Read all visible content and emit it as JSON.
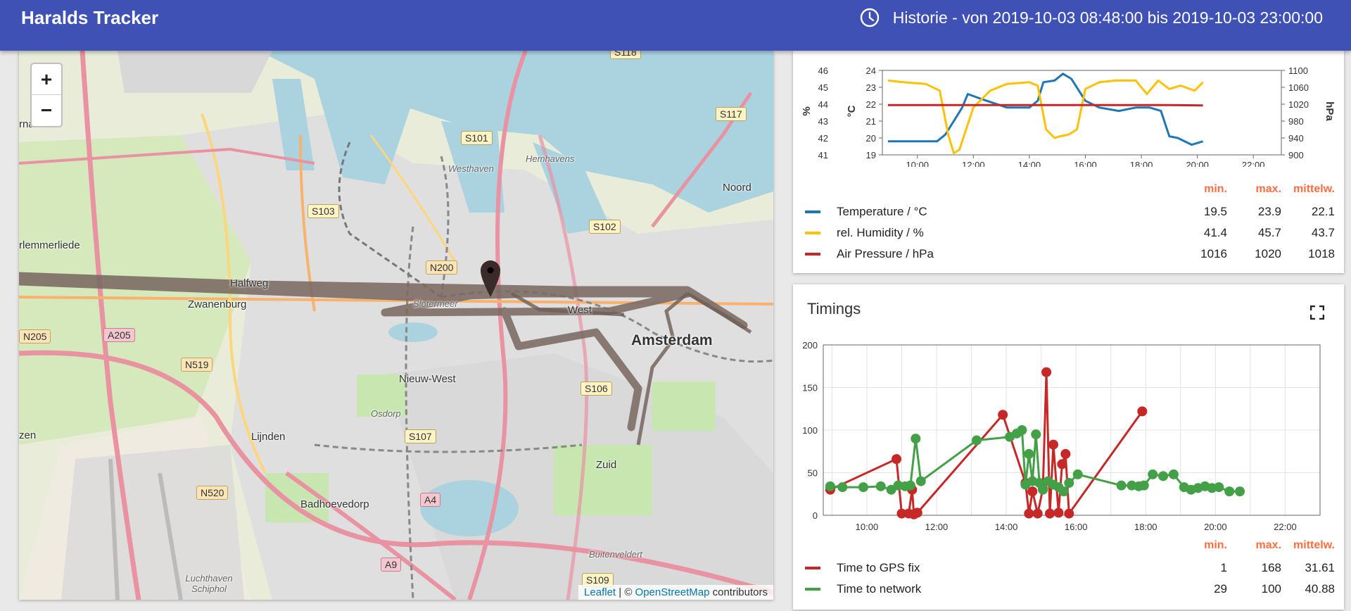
{
  "header": {
    "title": "Haralds Tracker",
    "history": "Historie - von 2019-10-03 08:48:00 bis 2019-10-03 23:00:00"
  },
  "map": {
    "zoom_in": "+",
    "zoom_out": "−",
    "attribution": {
      "leaflet": "Leaflet",
      "sep": " | © ",
      "osm": "OpenStreetMap",
      "suffix": " contributors"
    },
    "labels": [
      {
        "text": "Amsterdam",
        "cls": "city"
      },
      {
        "text": "West",
        "cls": "town"
      },
      {
        "text": "Nieuw-West",
        "cls": "town"
      },
      {
        "text": "Zuid",
        "cls": "town"
      },
      {
        "text": "Noord",
        "cls": "town"
      },
      {
        "text": "Halfweg",
        "cls": "town"
      },
      {
        "text": "Zwanenburg",
        "cls": "town"
      },
      {
        "text": "Lijnden",
        "cls": "town"
      },
      {
        "text": "Badhoevedorp",
        "cls": "town"
      },
      {
        "text": "Westhaven",
        "cls": "area"
      },
      {
        "text": "Hemhavens",
        "cls": "area"
      },
      {
        "text": "Slotermeer",
        "cls": "area"
      },
      {
        "text": "Osdorp",
        "cls": "area"
      },
      {
        "text": "Buitenveldert",
        "cls": "area"
      },
      {
        "text": "Luchthaven Schiphol",
        "cls": "area"
      },
      {
        "text": "rlemmerliede",
        "cls": "town"
      },
      {
        "text": "zen",
        "cls": "town"
      },
      {
        "text": "rnam",
        "cls": "town"
      }
    ],
    "shields": [
      {
        "text": "S118"
      },
      {
        "text": "S101"
      },
      {
        "text": "S103"
      },
      {
        "text": "S102"
      },
      {
        "text": "S117"
      },
      {
        "text": "N200"
      },
      {
        "text": "N205"
      },
      {
        "text": "A205"
      },
      {
        "text": "N519"
      },
      {
        "text": "S106"
      },
      {
        "text": "S107"
      },
      {
        "text": "N520"
      },
      {
        "text": "A4"
      },
      {
        "text": "A9"
      },
      {
        "text": "S109"
      }
    ]
  },
  "environment": {
    "chart_data": {
      "type": "line",
      "x_tick_labels": [
        "10:00",
        "12:00",
        "14:00",
        "16:00",
        "18:00",
        "20:00",
        "22:00"
      ],
      "xlim": [
        8.75,
        23.0
      ],
      "axes": {
        "humidity": {
          "label": "%",
          "ticks": [
            41,
            42,
            43,
            44,
            45,
            46
          ],
          "ylim": [
            41,
            46
          ]
        },
        "temperature": {
          "label": "°C",
          "ticks": [
            19,
            20,
            21,
            22,
            23,
            24
          ],
          "ylim": [
            19,
            24
          ]
        },
        "pressure": {
          "label": "hPa",
          "ticks": [
            900,
            940,
            980,
            1020,
            1060,
            1100
          ],
          "ylim": [
            900,
            1100
          ]
        }
      },
      "series": [
        {
          "name": "Temperature / °C",
          "axis": "temperature",
          "color": "#1f77b4",
          "x": [
            8.95,
            9.8,
            10.7,
            11.0,
            11.3,
            11.6,
            11.8,
            12.3,
            13.2,
            14.0,
            14.3,
            14.5,
            14.9,
            15.2,
            15.5,
            16.0,
            16.5,
            17.2,
            17.8,
            18.3,
            18.7,
            19.0,
            19.3,
            19.8,
            20.2
          ],
          "y": [
            19.8,
            19.8,
            19.8,
            20.2,
            21.0,
            21.8,
            22.6,
            22.3,
            21.8,
            21.8,
            22.2,
            23.3,
            23.4,
            23.8,
            23.5,
            22.2,
            21.8,
            21.6,
            21.8,
            21.8,
            21.6,
            20.1,
            20.0,
            19.6,
            19.8
          ]
        },
        {
          "name": "rel. Humidity / %",
          "axis": "humidity",
          "color": "#ffc107",
          "x": [
            8.95,
            9.5,
            10.3,
            10.8,
            11.1,
            11.3,
            11.5,
            12.0,
            12.6,
            13.2,
            14.0,
            14.3,
            14.6,
            14.9,
            15.1,
            15.4,
            15.7,
            16.0,
            16.5,
            17.1,
            17.8,
            18.2,
            18.6,
            19.0,
            19.4,
            19.9,
            20.2
          ],
          "y": [
            45.4,
            45.3,
            45.2,
            44.8,
            42.2,
            41.1,
            41.3,
            43.8,
            44.8,
            45.2,
            45.3,
            45.1,
            42.5,
            42.0,
            42.1,
            42.2,
            42.5,
            44.9,
            45.3,
            45.4,
            45.4,
            44.6,
            45.4,
            44.9,
            45.1,
            44.8,
            45.3
          ]
        },
        {
          "name": "Air Pressure / hPa",
          "axis": "pressure",
          "color": "#c62828",
          "x": [
            8.95,
            11.0,
            13.0,
            15.0,
            17.0,
            19.0,
            20.2
          ],
          "y": [
            1018,
            1018,
            1018,
            1018,
            1018,
            1018,
            1017
          ]
        }
      ]
    },
    "stats": {
      "headers": {
        "min": "min.",
        "max": "max.",
        "avg": "mittelw."
      },
      "rows": [
        {
          "label": "Temperature / °C",
          "color": "#1f77b4",
          "min": "19.5",
          "max": "23.9",
          "avg": "22.1"
        },
        {
          "label": "rel. Humidity / %",
          "color": "#ffc107",
          "min": "41.4",
          "max": "45.7",
          "avg": "43.7"
        },
        {
          "label": "Air Pressure / hPa",
          "color": "#c62828",
          "min": "1016",
          "max": "1020",
          "avg": "1018"
        }
      ]
    }
  },
  "timings": {
    "title": "Timings",
    "expand_icon": "fullscreen-icon",
    "chart_data": {
      "type": "line",
      "x_tick_labels": [
        "10:00",
        "12:00",
        "14:00",
        "16:00",
        "18:00",
        "20:00",
        "22:00"
      ],
      "xlim": [
        8.75,
        23.0
      ],
      "ylim": [
        0,
        200
      ],
      "y_ticks": [
        0,
        50,
        100,
        150,
        200
      ],
      "series": [
        {
          "name": "Time to GPS fix",
          "color": "#c62828",
          "x": [
            8.95,
            10.85,
            11.0,
            11.2,
            11.3,
            11.35,
            11.45,
            13.9,
            14.55,
            14.65,
            14.75,
            14.9,
            15.05,
            15.15,
            15.25,
            15.35,
            15.5,
            15.6,
            15.7,
            15.8,
            17.9
          ],
          "y": [
            30,
            66,
            2,
            2,
            30,
            1,
            3,
            118,
            38,
            2,
            28,
            2,
            31,
            168,
            2,
            83,
            3,
            60,
            72,
            2,
            122
          ]
        },
        {
          "name": "Time to network",
          "color": "#43a047",
          "x": [
            8.95,
            9.3,
            9.9,
            10.4,
            10.7,
            10.9,
            11.1,
            11.25,
            11.4,
            11.55,
            13.15,
            14.1,
            14.3,
            14.45,
            14.55,
            14.65,
            14.75,
            14.85,
            14.95,
            15.05,
            15.2,
            15.35,
            15.5,
            15.65,
            15.8,
            16.05,
            17.3,
            17.6,
            17.8,
            17.95,
            18.2,
            18.5,
            18.8,
            19.1,
            19.3,
            19.5,
            19.7,
            19.9,
            20.1,
            20.4,
            20.7
          ],
          "y": [
            34,
            33,
            33,
            34,
            30,
            35,
            34,
            35,
            90,
            40,
            88,
            92,
            96,
            100,
            36,
            72,
            40,
            95,
            38,
            30,
            40,
            36,
            33,
            28,
            38,
            48,
            35,
            35,
            34,
            35,
            48,
            46,
            48,
            33,
            30,
            32,
            34,
            32,
            33,
            28,
            28
          ]
        }
      ]
    },
    "stats": {
      "headers": {
        "min": "min.",
        "max": "max.",
        "avg": "mittelw."
      },
      "rows": [
        {
          "label": "Time to GPS fix",
          "color": "#c62828",
          "min": "1",
          "max": "168",
          "avg": "31.61"
        },
        {
          "label": "Time to network",
          "color": "#43a047",
          "min": "29",
          "max": "100",
          "avg": "40.88"
        }
      ]
    }
  }
}
